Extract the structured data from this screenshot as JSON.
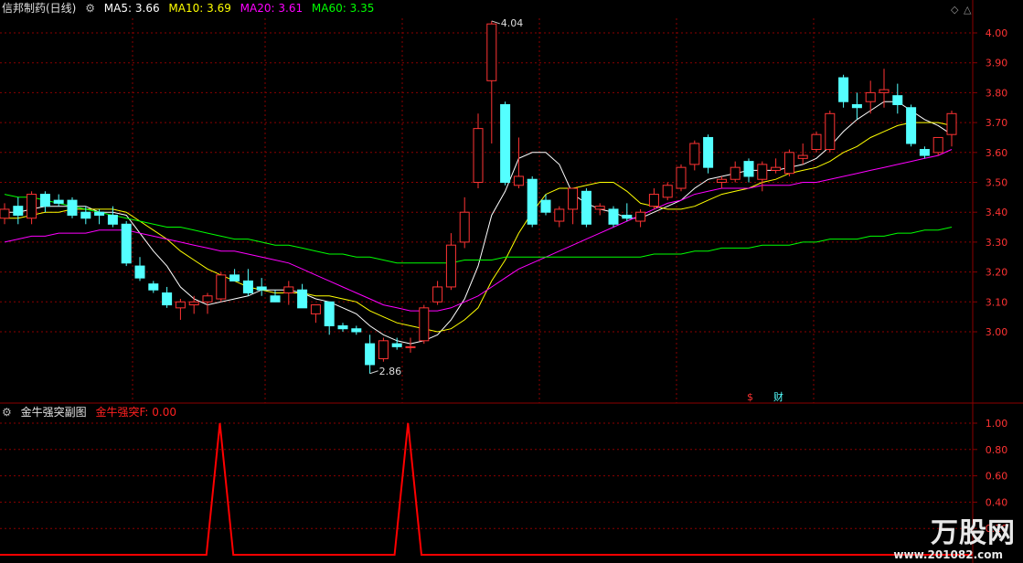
{
  "header": {
    "stock_name": "信邦制药(日线)",
    "ma5_label": "MA5:",
    "ma5_value": "3.66",
    "ma10_label": "MA10:",
    "ma10_value": "3.69",
    "ma20_label": "MA20:",
    "ma20_value": "3.61",
    "ma60_label": "MA60:",
    "ma60_value": "3.35"
  },
  "sub_header": {
    "indicator_name": "金牛强突副图",
    "value_label": "金牛强突F: 0.00"
  },
  "colors": {
    "ma5": "#ffffff",
    "ma10": "#ffff00",
    "ma20": "#ff00ff",
    "ma60": "#00ff00",
    "up": "#ff3333",
    "down": "#54ffff",
    "grid": "#8b0000",
    "axis_text": "#ff3333",
    "indicator": "#ff0000"
  },
  "markers": {
    "dollar": "$",
    "finance": "财"
  },
  "watermark": {
    "logo": "万股网",
    "url": "www.201082.com"
  },
  "chart_data": [
    {
      "type": "candlestick",
      "title": "信邦制药(日线)",
      "ylim": [
        2.78,
        4.08
      ],
      "y_ticks": [
        "4.00",
        "3.90",
        "3.80",
        "3.70",
        "3.60",
        "3.50",
        "3.40",
        "3.30",
        "3.20",
        "3.10",
        "3.00"
      ],
      "annotations": [
        {
          "label": "4.04",
          "index": 36,
          "value": 4.04
        },
        {
          "label": "2.86",
          "index": 27,
          "value": 2.86
        }
      ],
      "candles": [
        [
          3.38,
          3.43,
          3.36,
          3.41
        ],
        [
          3.42,
          3.45,
          3.36,
          3.39
        ],
        [
          3.38,
          3.47,
          3.36,
          3.46
        ],
        [
          3.46,
          3.47,
          3.4,
          3.42
        ],
        [
          3.44,
          3.46,
          3.42,
          3.43
        ],
        [
          3.44,
          3.45,
          3.38,
          3.39
        ],
        [
          3.4,
          3.42,
          3.36,
          3.38
        ],
        [
          3.4,
          3.41,
          3.36,
          3.39
        ],
        [
          3.39,
          3.42,
          3.35,
          3.36
        ],
        [
          3.36,
          3.37,
          3.22,
          3.23
        ],
        [
          3.22,
          3.25,
          3.17,
          3.18
        ],
        [
          3.16,
          3.17,
          3.13,
          3.14
        ],
        [
          3.13,
          3.15,
          3.08,
          3.09
        ],
        [
          3.08,
          3.11,
          3.04,
          3.1
        ],
        [
          3.09,
          3.12,
          3.06,
          3.1
        ],
        [
          3.1,
          3.13,
          3.06,
          3.12
        ],
        [
          3.11,
          3.2,
          3.1,
          3.19
        ],
        [
          3.19,
          3.21,
          3.17,
          3.17
        ],
        [
          3.17,
          3.21,
          3.12,
          3.13
        ],
        [
          3.15,
          3.18,
          3.12,
          3.14
        ],
        [
          3.12,
          3.14,
          3.1,
          3.1
        ],
        [
          3.13,
          3.17,
          3.09,
          3.15
        ],
        [
          3.14,
          3.16,
          3.08,
          3.08
        ],
        [
          3.06,
          3.09,
          3.03,
          3.09
        ],
        [
          3.1,
          3.1,
          2.99,
          3.02
        ],
        [
          3.02,
          3.03,
          3.0,
          3.01
        ],
        [
          3.01,
          3.02,
          2.99,
          3.0
        ],
        [
          2.96,
          2.99,
          2.86,
          2.89
        ],
        [
          2.91,
          2.98,
          2.9,
          2.97
        ],
        [
          2.96,
          2.98,
          2.94,
          2.95
        ],
        [
          2.95,
          2.98,
          2.93,
          2.95
        ],
        [
          2.97,
          3.09,
          2.96,
          3.08
        ],
        [
          3.1,
          3.17,
          3.09,
          3.15
        ],
        [
          3.15,
          3.33,
          3.14,
          3.29
        ],
        [
          3.3,
          3.45,
          3.28,
          3.4
        ],
        [
          3.5,
          3.73,
          3.48,
          3.68
        ],
        [
          3.84,
          4.04,
          3.63,
          4.03
        ],
        [
          3.76,
          3.77,
          3.49,
          3.5
        ],
        [
          3.49,
          3.65,
          3.48,
          3.52
        ],
        [
          3.51,
          3.52,
          3.35,
          3.36
        ],
        [
          3.44,
          3.46,
          3.39,
          3.4
        ],
        [
          3.37,
          3.42,
          3.35,
          3.41
        ],
        [
          3.41,
          3.48,
          3.36,
          3.48
        ],
        [
          3.47,
          3.48,
          3.35,
          3.36
        ],
        [
          3.41,
          3.43,
          3.39,
          3.42
        ],
        [
          3.41,
          3.42,
          3.35,
          3.36
        ],
        [
          3.39,
          3.43,
          3.37,
          3.38
        ],
        [
          3.37,
          3.41,
          3.35,
          3.4
        ],
        [
          3.42,
          3.48,
          3.41,
          3.46
        ],
        [
          3.45,
          3.5,
          3.44,
          3.49
        ],
        [
          3.48,
          3.56,
          3.47,
          3.55
        ],
        [
          3.56,
          3.64,
          3.54,
          3.63
        ],
        [
          3.65,
          3.66,
          3.53,
          3.55
        ],
        [
          3.5,
          3.52,
          3.48,
          3.51
        ],
        [
          3.51,
          3.57,
          3.5,
          3.55
        ],
        [
          3.57,
          3.58,
          3.5,
          3.52
        ],
        [
          3.51,
          3.57,
          3.47,
          3.56
        ],
        [
          3.54,
          3.58,
          3.53,
          3.55
        ],
        [
          3.53,
          3.61,
          3.52,
          3.6
        ],
        [
          3.58,
          3.63,
          3.56,
          3.59
        ],
        [
          3.61,
          3.67,
          3.6,
          3.66
        ],
        [
          3.61,
          3.74,
          3.6,
          3.73
        ],
        [
          3.85,
          3.86,
          3.75,
          3.77
        ],
        [
          3.76,
          3.8,
          3.71,
          3.75
        ],
        [
          3.77,
          3.84,
          3.73,
          3.8
        ],
        [
          3.8,
          3.88,
          3.75,
          3.81
        ],
        [
          3.79,
          3.83,
          3.73,
          3.76
        ],
        [
          3.75,
          3.76,
          3.62,
          3.63
        ],
        [
          3.61,
          3.62,
          3.58,
          3.59
        ],
        [
          3.6,
          3.65,
          3.59,
          3.65
        ],
        [
          3.66,
          3.74,
          3.62,
          3.73
        ]
      ],
      "series": [
        {
          "name": "MA5",
          "values": [
            3.4,
            3.4,
            3.41,
            3.42,
            3.42,
            3.42,
            3.42,
            3.4,
            3.4,
            3.39,
            3.33,
            3.27,
            3.22,
            3.15,
            3.11,
            3.09,
            3.1,
            3.11,
            3.12,
            3.14,
            3.14,
            3.14,
            3.13,
            3.11,
            3.1,
            3.08,
            3.06,
            3.02,
            2.99,
            2.97,
            2.96,
            2.97,
            2.99,
            3.04,
            3.11,
            3.22,
            3.39,
            3.47,
            3.58,
            3.6,
            3.6,
            3.56,
            3.46,
            3.43,
            3.41,
            3.4,
            3.38,
            3.38,
            3.4,
            3.42,
            3.44,
            3.48,
            3.51,
            3.52,
            3.53,
            3.54,
            3.54,
            3.54,
            3.55,
            3.56,
            3.58,
            3.62,
            3.67,
            3.71,
            3.74,
            3.77,
            3.77,
            3.74,
            3.71,
            3.69,
            3.66
          ]
        },
        {
          "name": "MA10",
          "values": [
            3.38,
            3.38,
            3.39,
            3.4,
            3.4,
            3.41,
            3.41,
            3.41,
            3.41,
            3.4,
            3.37,
            3.34,
            3.31,
            3.27,
            3.24,
            3.21,
            3.19,
            3.17,
            3.15,
            3.14,
            3.13,
            3.13,
            3.13,
            3.12,
            3.12,
            3.11,
            3.1,
            3.07,
            3.05,
            3.03,
            3.02,
            3.01,
            3.0,
            3.01,
            3.04,
            3.08,
            3.17,
            3.24,
            3.33,
            3.4,
            3.46,
            3.48,
            3.48,
            3.49,
            3.5,
            3.5,
            3.47,
            3.43,
            3.42,
            3.41,
            3.41,
            3.42,
            3.44,
            3.46,
            3.47,
            3.48,
            3.5,
            3.51,
            3.53,
            3.54,
            3.55,
            3.57,
            3.6,
            3.62,
            3.65,
            3.67,
            3.69,
            3.7,
            3.7,
            3.7,
            3.69
          ]
        },
        {
          "name": "MA20",
          "values": [
            3.3,
            3.31,
            3.32,
            3.32,
            3.33,
            3.33,
            3.33,
            3.34,
            3.34,
            3.34,
            3.33,
            3.32,
            3.31,
            3.3,
            3.29,
            3.28,
            3.27,
            3.27,
            3.26,
            3.25,
            3.24,
            3.23,
            3.21,
            3.19,
            3.17,
            3.15,
            3.13,
            3.11,
            3.09,
            3.08,
            3.07,
            3.07,
            3.07,
            3.08,
            3.1,
            3.12,
            3.15,
            3.18,
            3.21,
            3.23,
            3.25,
            3.27,
            3.29,
            3.31,
            3.33,
            3.35,
            3.37,
            3.39,
            3.41,
            3.43,
            3.44,
            3.46,
            3.47,
            3.48,
            3.48,
            3.48,
            3.49,
            3.49,
            3.49,
            3.5,
            3.5,
            3.51,
            3.52,
            3.53,
            3.54,
            3.55,
            3.56,
            3.57,
            3.58,
            3.59,
            3.61
          ]
        },
        {
          "name": "MA60",
          "values": [
            3.46,
            3.45,
            3.45,
            3.44,
            3.43,
            3.42,
            3.41,
            3.4,
            3.39,
            3.38,
            3.37,
            3.36,
            3.35,
            3.35,
            3.34,
            3.33,
            3.32,
            3.31,
            3.31,
            3.3,
            3.29,
            3.29,
            3.28,
            3.27,
            3.26,
            3.26,
            3.25,
            3.25,
            3.24,
            3.23,
            3.23,
            3.23,
            3.23,
            3.23,
            3.24,
            3.24,
            3.24,
            3.25,
            3.25,
            3.25,
            3.25,
            3.25,
            3.25,
            3.25,
            3.25,
            3.25,
            3.25,
            3.25,
            3.26,
            3.26,
            3.26,
            3.27,
            3.27,
            3.28,
            3.28,
            3.28,
            3.29,
            3.29,
            3.29,
            3.3,
            3.3,
            3.31,
            3.31,
            3.31,
            3.32,
            3.32,
            3.33,
            3.33,
            3.34,
            3.34,
            3.35
          ]
        }
      ]
    },
    {
      "type": "line",
      "title": "金牛强突副图",
      "name": "金牛强突F",
      "ylim": [
        0,
        1.05
      ],
      "y_ticks": [
        "1.00",
        "0.80",
        "0.60",
        "0.40",
        "0.20"
      ],
      "values": [
        0,
        0,
        0,
        0,
        0,
        0,
        0,
        0,
        0,
        0,
        0,
        0,
        0,
        0,
        0,
        1,
        0,
        0,
        0,
        0,
        0,
        0,
        0,
        0,
        0,
        0,
        0,
        0,
        0,
        1,
        0,
        0,
        0,
        0,
        0,
        0,
        0,
        0,
        0,
        0,
        0,
        0,
        0,
        0,
        0,
        0,
        0,
        0,
        0,
        0,
        0,
        0,
        0,
        0,
        0,
        0,
        0,
        0,
        0,
        0,
        0,
        0,
        0,
        0,
        0,
        0,
        0,
        0,
        0,
        0,
        0
      ]
    }
  ]
}
